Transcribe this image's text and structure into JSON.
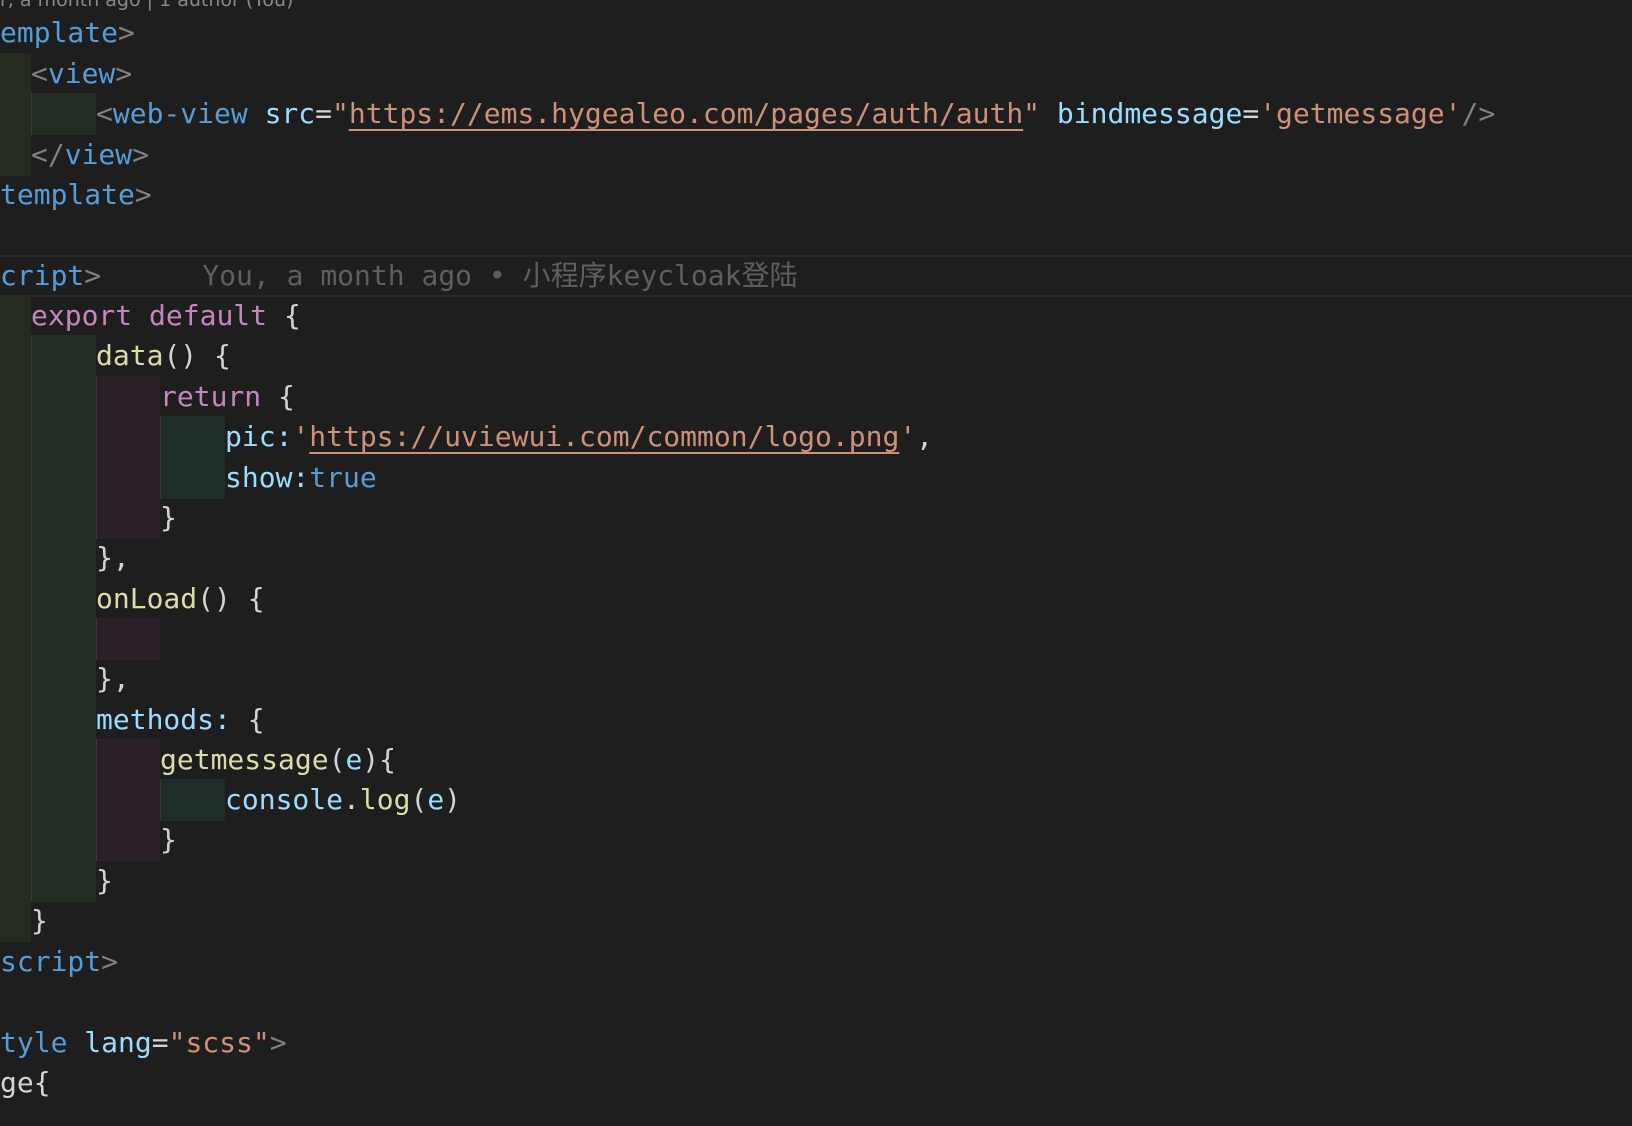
{
  "blame_top": "r, a month ago | 1 author (You)",
  "inline_blame": "You, a month ago • 小程序keycloak登陆",
  "code": {
    "l1_tag": "emplate",
    "l2_tag": "view",
    "l3_tag": "web-view",
    "l3_src_attr": "src",
    "l3_src_url": "https://ems.hygealeo.com/pages/auth/auth",
    "l3_bind_attr": "bindmessage",
    "l3_bind_val": "getmessage",
    "l4_tag": "view",
    "l5_tag": "template",
    "l7_tag": "cript",
    "l8_export": "export",
    "l8_default": "default",
    "l9_fn": "data",
    "l10_kw": "return",
    "l11_prop": "pic:",
    "l11_url": "https://uviewui.com/common/logo.png",
    "l12_prop": "show:",
    "l12_val": "true",
    "l15_fn": "onLoad",
    "l18_prop": "methods:",
    "l19_fn": "getmessage",
    "l19_param": "e",
    "l20_obj": "console",
    "l20_fn": "log",
    "l20_param": "e",
    "l24_tag": "script",
    "l26_tag": "tyle",
    "l26_attr": "lang",
    "l26_val": "scss",
    "l27_text": "ge{"
  }
}
